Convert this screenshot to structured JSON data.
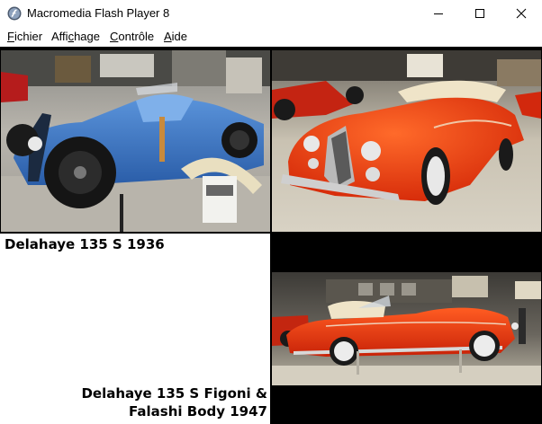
{
  "window": {
    "title": "Macromedia Flash Player 8"
  },
  "menu": [
    {
      "prefix": "",
      "underlined": "F",
      "rest": "ichier"
    },
    {
      "prefix": "Affi",
      "underlined": "c",
      "rest": "hage"
    },
    {
      "prefix": "",
      "underlined": "C",
      "rest": "ontrôle"
    },
    {
      "prefix": "",
      "underlined": "A",
      "rest": "ide"
    }
  ],
  "captions": {
    "car1": "Delahaye 135 S 1936",
    "car2_line1": "Delahaye 135 S Figoni &",
    "car2_line2": "Falashi Body 1947"
  },
  "colors": {
    "stage": "#000000",
    "car1_body": "#3a78c8",
    "car2_body": "#e8300c"
  }
}
